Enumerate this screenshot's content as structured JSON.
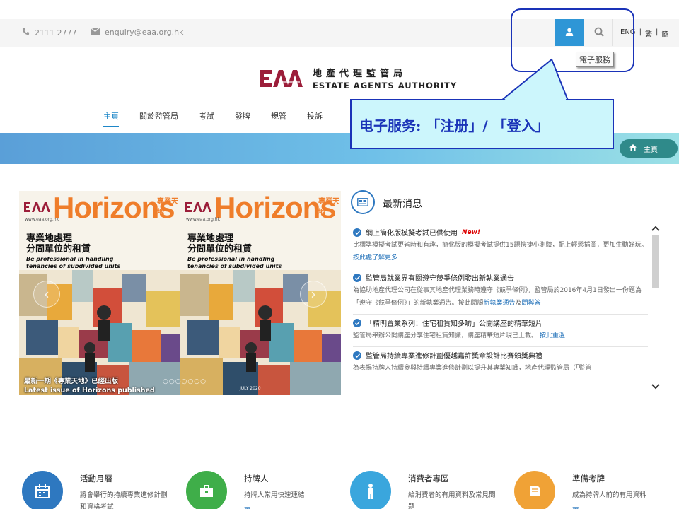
{
  "topbar": {
    "phone": "2111 2777",
    "email": "enquiry@eaa.org.hk",
    "lang": [
      "ENG",
      "繁",
      "簡"
    ],
    "eservice_tooltip": "電子服務"
  },
  "header": {
    "logo_zh": "地產代理監管局",
    "logo_en": "ESTATE AGENTS AUTHORITY"
  },
  "nav": [
    "主頁",
    "關於監管局",
    "考試",
    "發牌",
    "規管",
    "投訴"
  ],
  "breadcrumb": {
    "home": "主頁"
  },
  "annotation": {
    "text": "电子服务: 「注册」/ 「登入」"
  },
  "carousel": {
    "brand": "Horizons",
    "tagline": "專業天地",
    "url": "www.eaa.org.hk",
    "zh_heading": [
      "專業地處理",
      "分間單位的租賃"
    ],
    "en_heading": [
      "Be professional in handling",
      "tenancies of subdivided units"
    ],
    "caption_zh": "最新一期《專業天地》已經出版",
    "caption_en": "Latest issue of Horizons published",
    "dots": "○○○○○○○",
    "issue_date": "JULY 2020"
  },
  "news": {
    "title": "最新消息",
    "items": [
      {
        "title": "網上簡化版模擬考試已供使用",
        "badge": "New!",
        "body": "比標準模擬考試更省時和有趣，簡化版的模擬考試提供15題快捷小測驗，配上輕鬆插圖，更加生動好玩。",
        "link": "按此處了解更多"
      },
      {
        "title": "監管局就業界有關遵守競爭條例發出新執業通告",
        "body": "為協助地產代理公司在從事其地產代理業務時遵守《競爭條例》，監管局於2016年4月1日發出一份題為「遵守《競爭條例》」的新執業通告。按此閱讀",
        "link": "新執業通告",
        "link_joiner": "及",
        "link2": "問與答"
      },
      {
        "title": "「精明置業系列：住宅租賃知多啲」公開講座的精華短片",
        "body": "監管局舉辦公開講座分享住宅租賃知識，講座精華短片現已上載。",
        "link": "按此重溫"
      },
      {
        "title": "監管局持續專業進修計劃優越嘉許獎章設計比賽頒獎典禮",
        "body": "為表揚持牌人持續參與持續專業進修計劃以提升其專業知識，地產代理監管局（「監管"
      }
    ]
  },
  "tiles": [
    {
      "name": "活動月曆",
      "desc": "將會舉行的持續專業進修計劃和資格考試",
      "color": "#2e78c0",
      "icon": "calendar-icon"
    },
    {
      "name": "持牌人",
      "desc": "持牌人常用快速連結",
      "more": "更多",
      "color": "#3fae49",
      "icon": "briefcase-icon"
    },
    {
      "name": "消費者專區",
      "desc": "給消費者的有用資料及常見問題",
      "color": "#3aa6dd",
      "icon": "person-icon"
    },
    {
      "name": "準備考牌",
      "desc": "成為持牌人前的有用資料",
      "more": "更多",
      "color": "#f0a236",
      "icon": "book-icon"
    }
  ]
}
